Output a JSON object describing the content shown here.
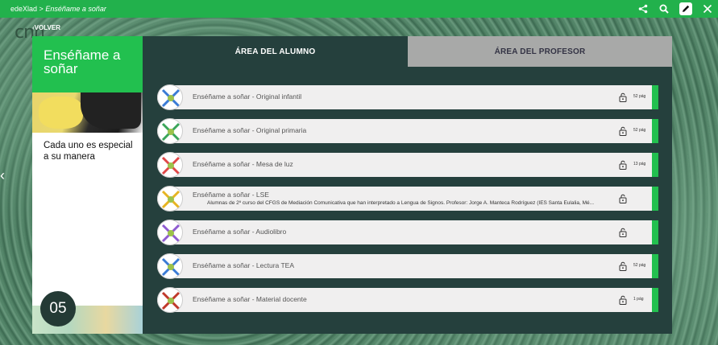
{
  "topbar": {
    "breadcrumb_root": "edeXlad",
    "breadcrumb_sep": ">",
    "breadcrumb_current": "Enséñame a soñar",
    "icons": [
      "share-icon",
      "search-icon",
      "pencil-icon",
      "close-icon"
    ]
  },
  "logo_text": "cnn",
  "back_label": "VOLVER",
  "card": {
    "title": "Enséñame a soñar",
    "subtitle": "Cada uno es especial a su manera",
    "number": "05"
  },
  "tabs": {
    "alumno": "ÁREA DEL ALUMNO",
    "profesor": "ÁREA DEL PROFESOR"
  },
  "colors": {
    "accent_green": "#22c04f",
    "panel_dark": "#25403d",
    "tab_inactive": "#a8a9a8"
  },
  "resources": [
    {
      "title": "Enséñame a soñar - Original infantil",
      "pages": "52 pág",
      "description": ""
    },
    {
      "title": "Enséñame a soñar - Original primaria",
      "pages": "52 pág",
      "description": ""
    },
    {
      "title": "Enséñame a soñar - Mesa de luz",
      "pages": "13 pág",
      "description": ""
    },
    {
      "title": "Enséñame a soñar - LSE",
      "pages": "",
      "description": "Alumnas de 2º curso del CFGS de Mediación Comunicativa que han interpretado a Lengua de Signos. Profesor: Jorge A. Manteca Rodríguez (IES Santa Eulalia, Mé..."
    },
    {
      "title": "Enséñame a soñar - Audiolibro",
      "pages": "",
      "description": ""
    },
    {
      "title": "Enséñame a soñar - Lectura TEA",
      "pages": "52 pág",
      "description": ""
    },
    {
      "title": "Enséñame a soñar - Material docente",
      "pages": "1 pág",
      "description": ""
    }
  ]
}
